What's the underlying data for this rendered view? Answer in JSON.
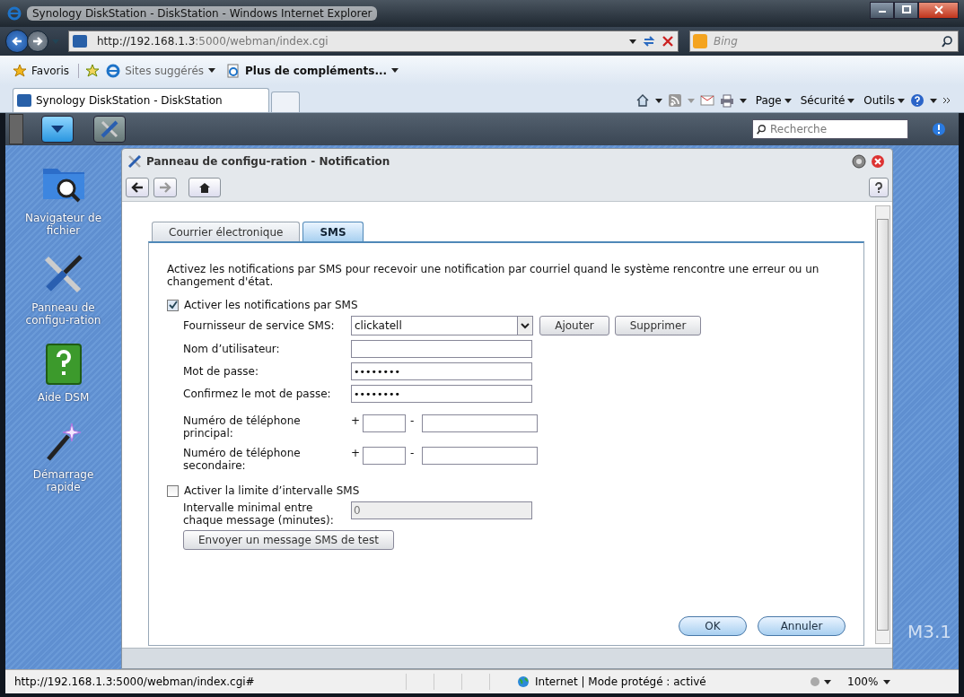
{
  "browser": {
    "title": "Synology DiskStation - DiskStation - Windows Internet Explorer",
    "address": {
      "host": "http://192.168.1.3",
      "rest": ":5000/webman/index.cgi"
    },
    "search": {
      "placeholder": "Bing"
    },
    "favorites": [
      {
        "label": "Favoris",
        "kind": "star"
      },
      {
        "label": "Sites suggérés",
        "kind": "ie"
      },
      {
        "label": "Plus de compléments...",
        "kind": "page"
      }
    ],
    "tab": {
      "title": "Synology DiskStation - DiskStation"
    },
    "commands": [
      "Page",
      "Sécurité",
      "Outils"
    ]
  },
  "dsm": {
    "search": {
      "placeholder": "Recherche"
    },
    "desktop_icons": [
      {
        "label": "Navigateur de fichier",
        "kind": "folder"
      },
      {
        "label": "Panneau de configu-ration",
        "kind": "tools"
      },
      {
        "label": "Aide DSM",
        "kind": "help"
      },
      {
        "label": "Démarrage rapide",
        "kind": "wand"
      }
    ],
    "version_mark": "M3.1"
  },
  "window": {
    "title": "Panneau de configu-ration - Notification",
    "tabs": [
      {
        "label": "Courrier électronique",
        "selected": false
      },
      {
        "label": "SMS",
        "selected": true
      }
    ],
    "description": "Activez les notifications par SMS pour recevoir une notification par courriel quand le système rencontre une erreur ou un changement d'état.",
    "enable_sms": {
      "label": "Activer les notifications par SMS",
      "checked": true
    },
    "provider": {
      "label": "Fournisseur de service SMS:",
      "value": "clickatell",
      "buttons": [
        "Ajouter",
        "Supprimer"
      ]
    },
    "fields": [
      {
        "label": "Nom d’utilisateur:"
      },
      {
        "label": "Mot de passe:",
        "value": "••••••••"
      },
      {
        "label": "Confirmez le mot de passe:",
        "value": "••••••••"
      }
    ],
    "phones": [
      {
        "label": "Numéro de téléphone principal:",
        "plus": "+",
        "dash": "-"
      },
      {
        "label": "Numéro de téléphone secondaire:",
        "plus": "+",
        "dash": "-"
      }
    ],
    "limit": {
      "label": "Activer la limite d’intervalle SMS",
      "checked": false
    },
    "interval": {
      "label": "Intervalle minimal entre chaque message (minutes):",
      "value": "0",
      "disabled": true
    },
    "test_button": "Envoyer un message SMS de test",
    "footer_buttons": [
      "OK",
      "Annuler"
    ]
  },
  "status_bar": {
    "url": "http://192.168.1.3:5000/webman/index.cgi#",
    "zone": "Internet | Mode protégé : activé",
    "zoom": "100%"
  }
}
